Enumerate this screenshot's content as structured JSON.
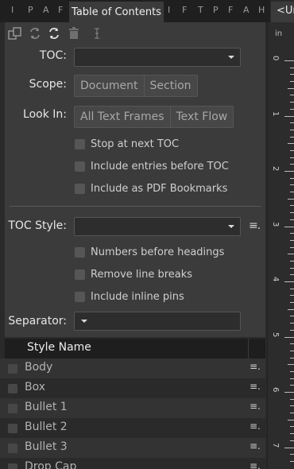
{
  "tabs": {
    "mini_labels": [
      "I",
      "P",
      "A",
      "F"
    ],
    "active": "Table of Contents",
    "mini_labels_after": [
      "I",
      "F",
      "T",
      "P",
      "F",
      "A",
      "H"
    ],
    "document": "<Ur"
  },
  "toolbar": {
    "icons": [
      "copy-icon",
      "refresh-icon",
      "update-icon",
      "trash-icon",
      "text-cursor-icon"
    ]
  },
  "form": {
    "toc_label": "TOC:",
    "toc_value": "",
    "scope_label": "Scope:",
    "scope_options": [
      "Document",
      "Section"
    ],
    "lookin_label": "Look In:",
    "lookin_options": [
      "All Text Frames",
      "Text Flow"
    ],
    "checkboxes": [
      {
        "label": "Stop at next TOC",
        "checked": false
      },
      {
        "label": "Include entries before TOC",
        "checked": false
      },
      {
        "label": "Include as PDF Bookmarks",
        "checked": false
      }
    ],
    "toc_style_label": "TOC Style:",
    "toc_style_value": "",
    "style_checkboxes": [
      {
        "label": "Numbers before headings",
        "checked": false
      },
      {
        "label": "Remove line breaks",
        "checked": false
      },
      {
        "label": "Include inline pins",
        "checked": false
      }
    ],
    "separator_label": "Separator:",
    "separator_value": ""
  },
  "styles_list": {
    "header": "Style Name",
    "rows": [
      "Body",
      "Box",
      "Bullet 1",
      "Bullet 2",
      "Bullet 3",
      "Drop Cap"
    ]
  },
  "ruler": {
    "unit": "in",
    "numbers": [
      "0",
      "1",
      "2",
      "3",
      "4",
      "5",
      "6",
      "7"
    ]
  }
}
